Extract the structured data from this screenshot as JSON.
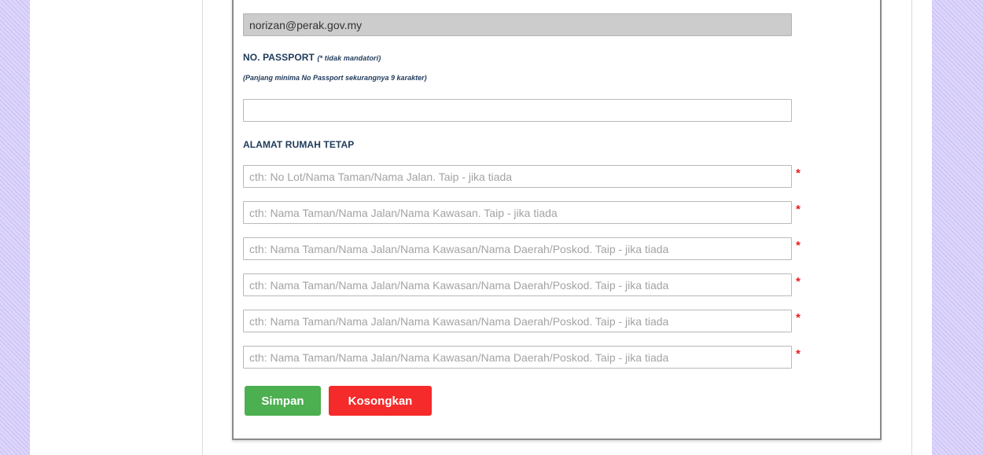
{
  "email": {
    "value": "norizan@perak.gov.my"
  },
  "passport": {
    "label": "NO. PASSPORT",
    "note": "(* tidak mandatori)",
    "hint": "(Panjang minima No Passport sekurangnya 9 karakter)",
    "value": ""
  },
  "address": {
    "label": "ALAMAT RUMAH TETAP",
    "required_mark": "*",
    "lines": [
      {
        "placeholder": "cth: No Lot/Nama Taman/Nama Jalan. Taip - jika tiada",
        "value": ""
      },
      {
        "placeholder": "cth: Nama Taman/Nama Jalan/Nama Kawasan. Taip - jika tiada",
        "value": ""
      },
      {
        "placeholder": "cth: Nama Taman/Nama Jalan/Nama Kawasan/Nama Daerah/Poskod. Taip - jika tiada",
        "value": ""
      },
      {
        "placeholder": "cth: Nama Taman/Nama Jalan/Nama Kawasan/Nama Daerah/Poskod. Taip - jika tiada",
        "value": ""
      },
      {
        "placeholder": "cth: Nama Taman/Nama Jalan/Nama Kawasan/Nama Daerah/Poskod. Taip - jika tiada",
        "value": ""
      },
      {
        "placeholder": "cth: Nama Taman/Nama Jalan/Nama Kawasan/Nama Daerah/Poskod. Taip - jika tiada",
        "value": ""
      }
    ]
  },
  "buttons": {
    "save_label": "Simpan",
    "clear_label": "Kosongkan"
  },
  "colors": {
    "save": "#4caf50",
    "clear": "#f52a2a",
    "label": "#1f3a5a",
    "required": "#e02020",
    "stripe": "#ddd6fb"
  }
}
